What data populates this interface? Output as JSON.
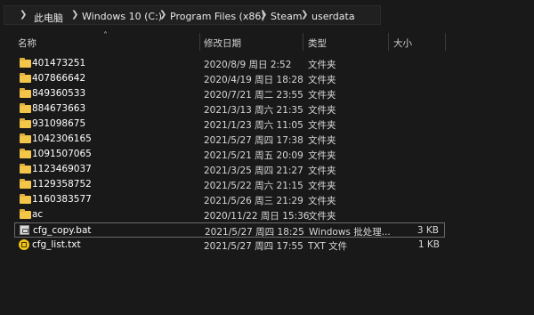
{
  "address": {
    "crumbs": [
      "此电脑",
      "Windows 10 (C:)",
      "Program Files (x86)",
      "Steam",
      "userdata"
    ]
  },
  "columns": {
    "name": "名称",
    "date": "修改日期",
    "type": "类型",
    "size": "大小"
  },
  "files": [
    {
      "name": "401473251",
      "date": "2020/8/9 周日 2:52",
      "type": "文件夹",
      "size": "",
      "icon": "folder-icon"
    },
    {
      "name": "407866642",
      "date": "2020/4/19 周日 18:28",
      "type": "文件夹",
      "size": "",
      "icon": "folder-icon"
    },
    {
      "name": "849360533",
      "date": "2020/7/21 周二 23:55",
      "type": "文件夹",
      "size": "",
      "icon": "folder-icon"
    },
    {
      "name": "884673663",
      "date": "2021/3/13 周六 21:35",
      "type": "文件夹",
      "size": "",
      "icon": "folder-icon"
    },
    {
      "name": "931098675",
      "date": "2021/1/23 周六 11:05",
      "type": "文件夹",
      "size": "",
      "icon": "folder-icon"
    },
    {
      "name": "1042306165",
      "date": "2021/5/27 周四 17:38",
      "type": "文件夹",
      "size": "",
      "icon": "folder-icon"
    },
    {
      "name": "1091507065",
      "date": "2021/5/21 周五 20:09",
      "type": "文件夹",
      "size": "",
      "icon": "folder-icon"
    },
    {
      "name": "1123469037",
      "date": "2021/3/25 周四 21:27",
      "type": "文件夹",
      "size": "",
      "icon": "folder-icon"
    },
    {
      "name": "1129358752",
      "date": "2021/5/22 周六 21:15",
      "type": "文件夹",
      "size": "",
      "icon": "folder-icon"
    },
    {
      "name": "1160383577",
      "date": "2021/5/26 周三 21:29",
      "type": "文件夹",
      "size": "",
      "icon": "folder-icon"
    },
    {
      "name": "ac",
      "date": "2020/11/22 周日 15:36",
      "type": "文件夹",
      "size": "",
      "icon": "folder-icon"
    },
    {
      "name": "cfg_copy.bat",
      "date": "2021/5/27 周四 18:25",
      "type": "Windows 批处理...",
      "size": "3 KB",
      "icon": "batch-file-icon"
    },
    {
      "name": "cfg_list.txt",
      "date": "2021/5/27 周四 17:55",
      "type": "TXT 文件",
      "size": "1 KB",
      "icon": "text-file-icon"
    }
  ],
  "colors": {
    "background": "#191919",
    "folder": "#f3c64a",
    "text": "#ffffff"
  }
}
